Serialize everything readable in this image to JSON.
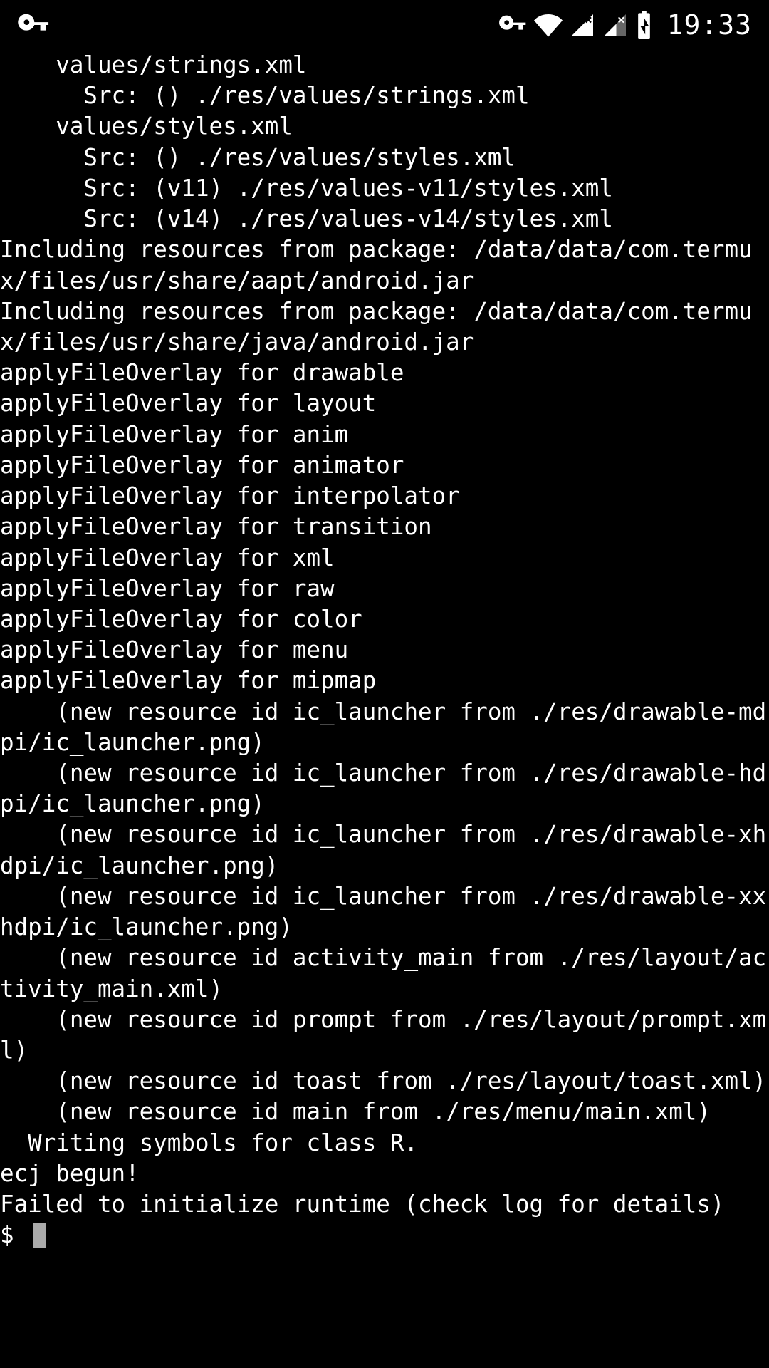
{
  "statusbar": {
    "clock": "19:33"
  },
  "terminal": {
    "lines": [
      "    values/strings.xml",
      "      Src: () ./res/values/strings.xml",
      "    values/styles.xml",
      "      Src: () ./res/values/styles.xml",
      "      Src: (v11) ./res/values-v11/styles.xml",
      "      Src: (v14) ./res/values-v14/styles.xml",
      "Including resources from package: /data/data/com.termux/files/usr/share/aapt/android.jar",
      "Including resources from package: /data/data/com.termux/files/usr/share/java/android.jar",
      "applyFileOverlay for drawable",
      "applyFileOverlay for layout",
      "applyFileOverlay for anim",
      "applyFileOverlay for animator",
      "applyFileOverlay for interpolator",
      "applyFileOverlay for transition",
      "applyFileOverlay for xml",
      "applyFileOverlay for raw",
      "applyFileOverlay for color",
      "applyFileOverlay for menu",
      "applyFileOverlay for mipmap",
      "    (new resource id ic_launcher from ./res/drawable-mdpi/ic_launcher.png)",
      "    (new resource id ic_launcher from ./res/drawable-hdpi/ic_launcher.png)",
      "    (new resource id ic_launcher from ./res/drawable-xhdpi/ic_launcher.png)",
      "    (new resource id ic_launcher from ./res/drawable-xxhdpi/ic_launcher.png)",
      "    (new resource id activity_main from ./res/layout/activity_main.xml)",
      "    (new resource id prompt from ./res/layout/prompt.xml)",
      "    (new resource id toast from ./res/layout/toast.xml)",
      "    (new resource id main from ./res/menu/main.xml)",
      "  Writing symbols for class R.",
      "ecj begun!",
      "Failed to initialize runtime (check log for details)"
    ],
    "prompt": "$ "
  }
}
